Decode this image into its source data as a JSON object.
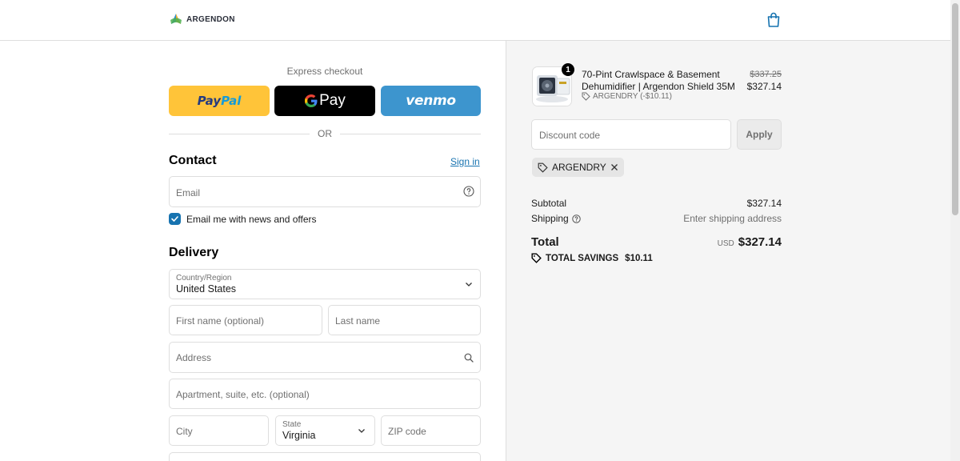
{
  "header": {
    "brand": "ARGENDON",
    "cart_icon": "shopping-bag-icon"
  },
  "express": {
    "label": "Express checkout",
    "paypal": {
      "part1": "Pay",
      "part2": "Pal"
    },
    "gpay": {
      "g": "G",
      "text": "Pay"
    },
    "venmo": "venmo",
    "or": "OR"
  },
  "contact": {
    "title": "Contact",
    "signin": "Sign in",
    "email_placeholder": "Email",
    "newsletter_label": "Email me with news and offers",
    "newsletter_checked": true
  },
  "delivery": {
    "title": "Delivery",
    "country_label": "Country/Region",
    "country_value": "United States",
    "first_name_placeholder": "First name (optional)",
    "last_name_placeholder": "Last name",
    "address_placeholder": "Address",
    "apartment_placeholder": "Apartment, suite, etc. (optional)",
    "city_placeholder": "City",
    "state_label": "State",
    "state_value": "Virginia",
    "zip_placeholder": "ZIP code"
  },
  "order": {
    "quantity": "1",
    "product_name": "70-Pint Crawlspace & Basement Dehumidifier | Argendon Shield 35M",
    "product_discount": "ARGENDRY (-$10.11)",
    "price_original": "$337.25",
    "price_final": "$327.14",
    "discount_placeholder": "Discount code",
    "apply_label": "Apply",
    "applied_code": "ARGENDRY",
    "subtotal_label": "Subtotal",
    "subtotal_value": "$327.14",
    "shipping_label": "Shipping",
    "shipping_value": "Enter shipping address",
    "total_label": "Total",
    "total_currency": "USD",
    "total_value": "$327.14",
    "savings_label": "TOTAL SAVINGS",
    "savings_value": "$10.11"
  },
  "colors": {
    "accent": "#1773b0",
    "paypal_yellow": "#ffc439",
    "venmo_blue": "#3d95ce"
  }
}
